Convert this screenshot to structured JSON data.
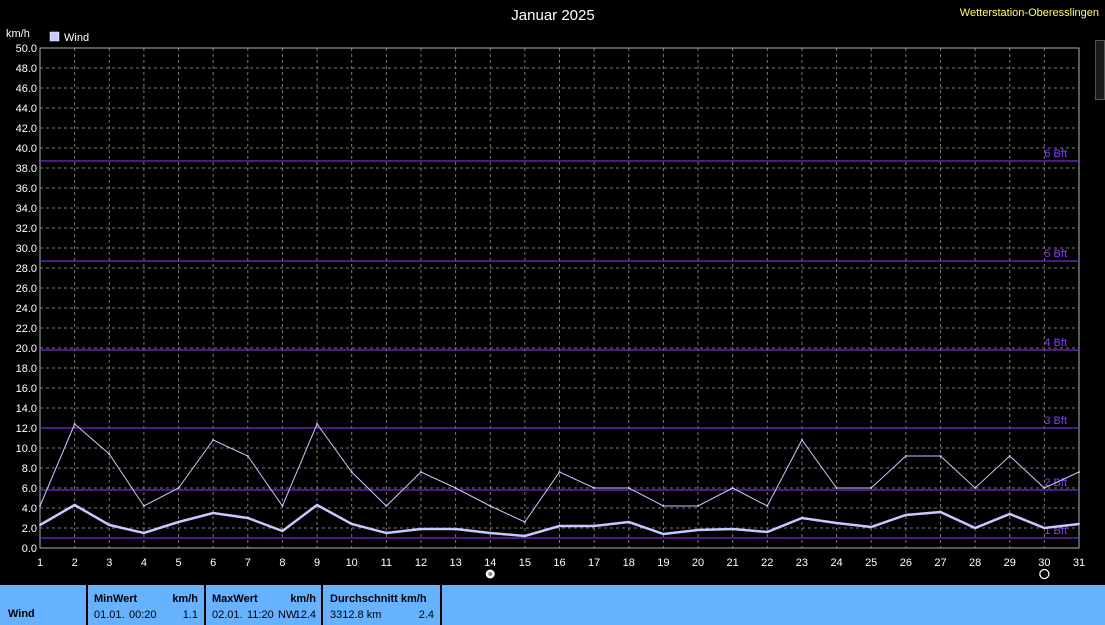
{
  "title": "Januar 2025",
  "station": "Wetterstation-Oberesslingen",
  "unit": "km/h",
  "legend": {
    "label": "Wind",
    "swatch_color": "#c8c8ff"
  },
  "colors": {
    "grid": "#7a7a7a",
    "beaufort_line": "#7a2bd8",
    "series": "#c8c8ff",
    "summary_bg": "#66b2ff"
  },
  "chart_data": {
    "type": "line",
    "title": "Januar 2025",
    "ylabel": "km/h",
    "ylim": [
      0,
      50
    ],
    "yticks": [
      "0.0",
      "2.0",
      "4.0",
      "6.0",
      "8.0",
      "10.0",
      "12.0",
      "14.0",
      "16.0",
      "18.0",
      "20.0",
      "22.0",
      "24.0",
      "26.0",
      "28.0",
      "30.0",
      "32.0",
      "34.0",
      "36.0",
      "38.0",
      "40.0",
      "42.0",
      "44.0",
      "46.0",
      "48.0",
      "50.0"
    ],
    "x": [
      1,
      2,
      3,
      4,
      5,
      6,
      7,
      8,
      9,
      10,
      11,
      12,
      13,
      14,
      15,
      16,
      17,
      18,
      19,
      20,
      21,
      22,
      23,
      24,
      25,
      26,
      27,
      28,
      29,
      30,
      31
    ],
    "grid": true,
    "legend_position": "top-left",
    "series": [
      {
        "name": "Wind",
        "role": "max",
        "values": [
          4.2,
          12.4,
          9.4,
          4.2,
          6.0,
          10.8,
          9.2,
          4.2,
          12.4,
          7.6,
          4.2,
          7.6,
          6.0,
          4.2,
          2.6,
          7.6,
          6.0,
          6.0,
          4.2,
          4.2,
          6.0,
          4.2,
          10.8,
          6.0,
          6.0,
          9.2,
          9.2,
          6.0,
          9.2,
          6.0,
          7.6
        ]
      },
      {
        "role": "avg",
        "values": [
          2.3,
          4.3,
          2.3,
          1.5,
          2.6,
          3.5,
          3.0,
          1.7,
          4.3,
          2.4,
          1.5,
          1.9,
          1.9,
          1.5,
          1.2,
          2.2,
          2.2,
          2.6,
          1.4,
          1.8,
          1.9,
          1.6,
          3.0,
          2.5,
          2.1,
          3.3,
          3.6,
          2.0,
          3.4,
          2.0,
          2.4
        ]
      }
    ],
    "reference_lines": [
      {
        "value": 1.0,
        "label": "1 Bft"
      },
      {
        "value": 5.8,
        "label": "2 Bft"
      },
      {
        "value": 12.0,
        "label": "3 Bft"
      },
      {
        "value": 19.8,
        "label": "4 Bft"
      },
      {
        "value": 28.7,
        "label": "5 Bft"
      },
      {
        "value": 38.7,
        "label": "6 Bft"
      }
    ],
    "moon_markers": [
      {
        "day": 14,
        "phase": "full"
      },
      {
        "day": 30,
        "phase": "new"
      }
    ]
  },
  "summary": {
    "row_label": "Wind",
    "min": {
      "header": "MinWert",
      "unit": "km/h",
      "date": "01.01.",
      "time": "00:20",
      "value": "1.1"
    },
    "max": {
      "header": "MaxWert",
      "unit": "km/h",
      "date": "02.01.",
      "time": "11:20",
      "dir": "NW",
      "value": "12.4"
    },
    "avg": {
      "header": "Durchschnitt km/h",
      "distance": "3312.8 km",
      "value": "2.4"
    }
  }
}
